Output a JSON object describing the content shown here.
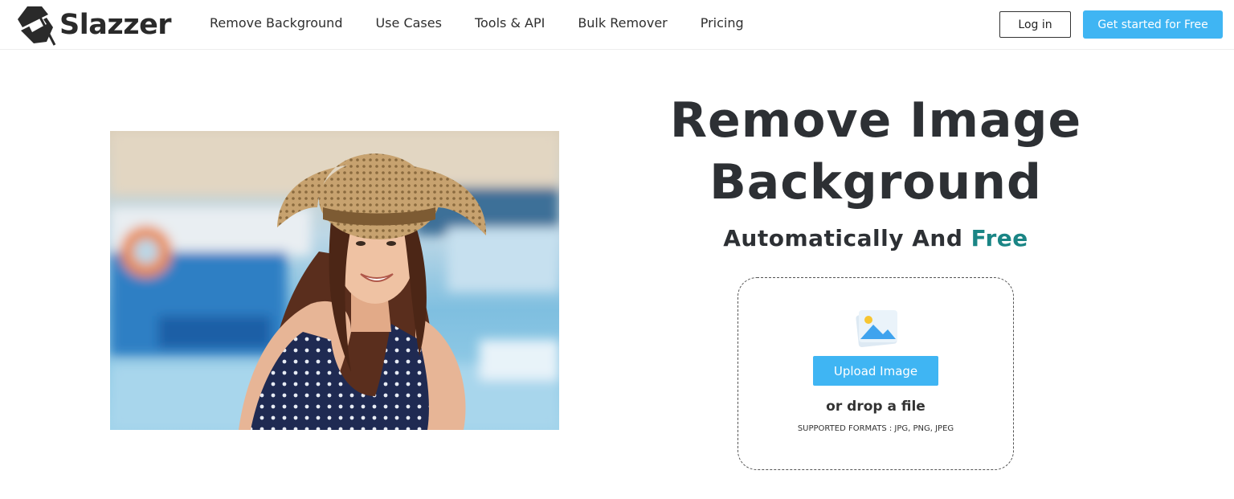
{
  "brand": {
    "name": "Slazzer",
    "logo_icon": "slazzer-logo-icon"
  },
  "nav": {
    "items": [
      {
        "label": "Remove Background"
      },
      {
        "label": "Use Cases"
      },
      {
        "label": "Tools & API"
      },
      {
        "label": "Bulk Remover"
      },
      {
        "label": "Pricing"
      }
    ]
  },
  "header": {
    "login_label": "Log in",
    "cta_label": "Get started for Free"
  },
  "hero": {
    "title_line1": "Remove Image",
    "title_line2": "Background",
    "subtitle_prefix": "Automatically And ",
    "subtitle_accent": "Free",
    "image_icon": "woman-in-sun-hat-photo"
  },
  "upload": {
    "icon": "image-upload-icon",
    "button_label": "Upload Image",
    "drop_text": "or drop a file",
    "formats_text": "SUPPORTED FORMATS : JPG, PNG, JPEG"
  },
  "colors": {
    "accent_blue": "#3fb5f3",
    "accent_teal": "#1a8585",
    "heading": "#2d3034"
  }
}
